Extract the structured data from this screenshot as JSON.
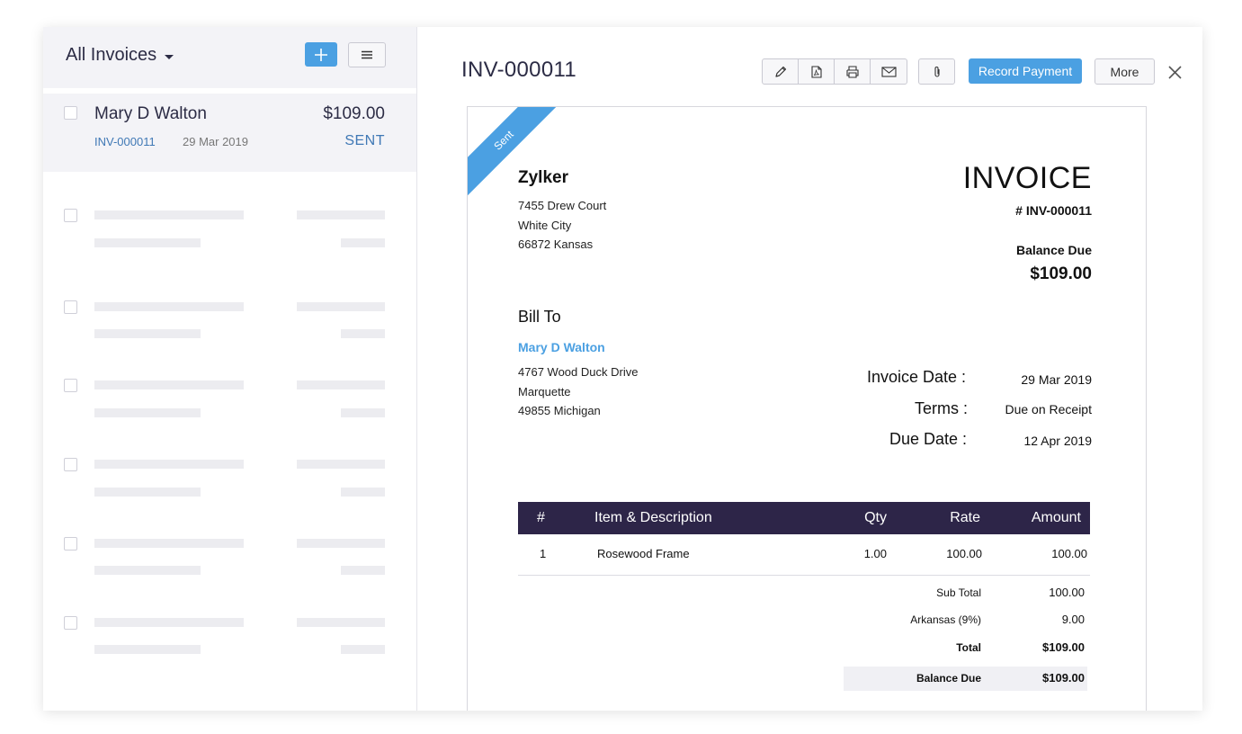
{
  "sidebar": {
    "title": "All Invoices",
    "active_item": {
      "customer": "Mary D Walton",
      "amount": "$109.00",
      "invoice_number": "INV-000011",
      "date": "29 Mar 2019",
      "status": "SENT"
    }
  },
  "header": {
    "title": "INV-000011",
    "record_payment_label": "Record Payment",
    "more_label": "More"
  },
  "invoice": {
    "ribbon": "Sent",
    "org_name": "Zylker",
    "org_address": [
      "7455 Drew Court",
      "White City",
      "66872 Kansas"
    ],
    "doc_title": "INVOICE",
    "doc_number": "# INV-000011",
    "balance_due_label": "Balance Due",
    "balance_due_value": "$109.00",
    "bill_to_label": "Bill To",
    "bill_to_name": "Mary D Walton",
    "bill_to_address": [
      "4767 Wood Duck Drive",
      "Marquette",
      "49855 Michigan"
    ],
    "meta": [
      {
        "label": "Invoice Date :",
        "value": "29 Mar 2019"
      },
      {
        "label": "Terms :",
        "value": "Due on Receipt"
      },
      {
        "label": "Due Date :",
        "value": "12 Apr 2019"
      }
    ],
    "table": {
      "headers": [
        "#",
        "Item & Description",
        "Qty",
        "Rate",
        "Amount"
      ],
      "rows": [
        {
          "num": "1",
          "item": "Rosewood Frame",
          "qty": "1.00",
          "rate": "100.00",
          "amount": "100.00"
        }
      ]
    },
    "totals": [
      {
        "label": "Sub Total",
        "value": "100.00"
      },
      {
        "label": "Arkansas (9%)",
        "value": "9.00"
      },
      {
        "label": "Total",
        "value": "$109.00"
      },
      {
        "label": "Balance Due",
        "value": "$109.00"
      }
    ]
  },
  "colors": {
    "accent": "#4ba0e2",
    "table_header": "#2d2548",
    "sidebar_bg": "#f3f3f7"
  },
  "icons": [
    "plus-icon",
    "menu-icon",
    "pencil-icon",
    "pdf-icon",
    "print-icon",
    "mail-icon",
    "paperclip-icon",
    "close-icon"
  ]
}
